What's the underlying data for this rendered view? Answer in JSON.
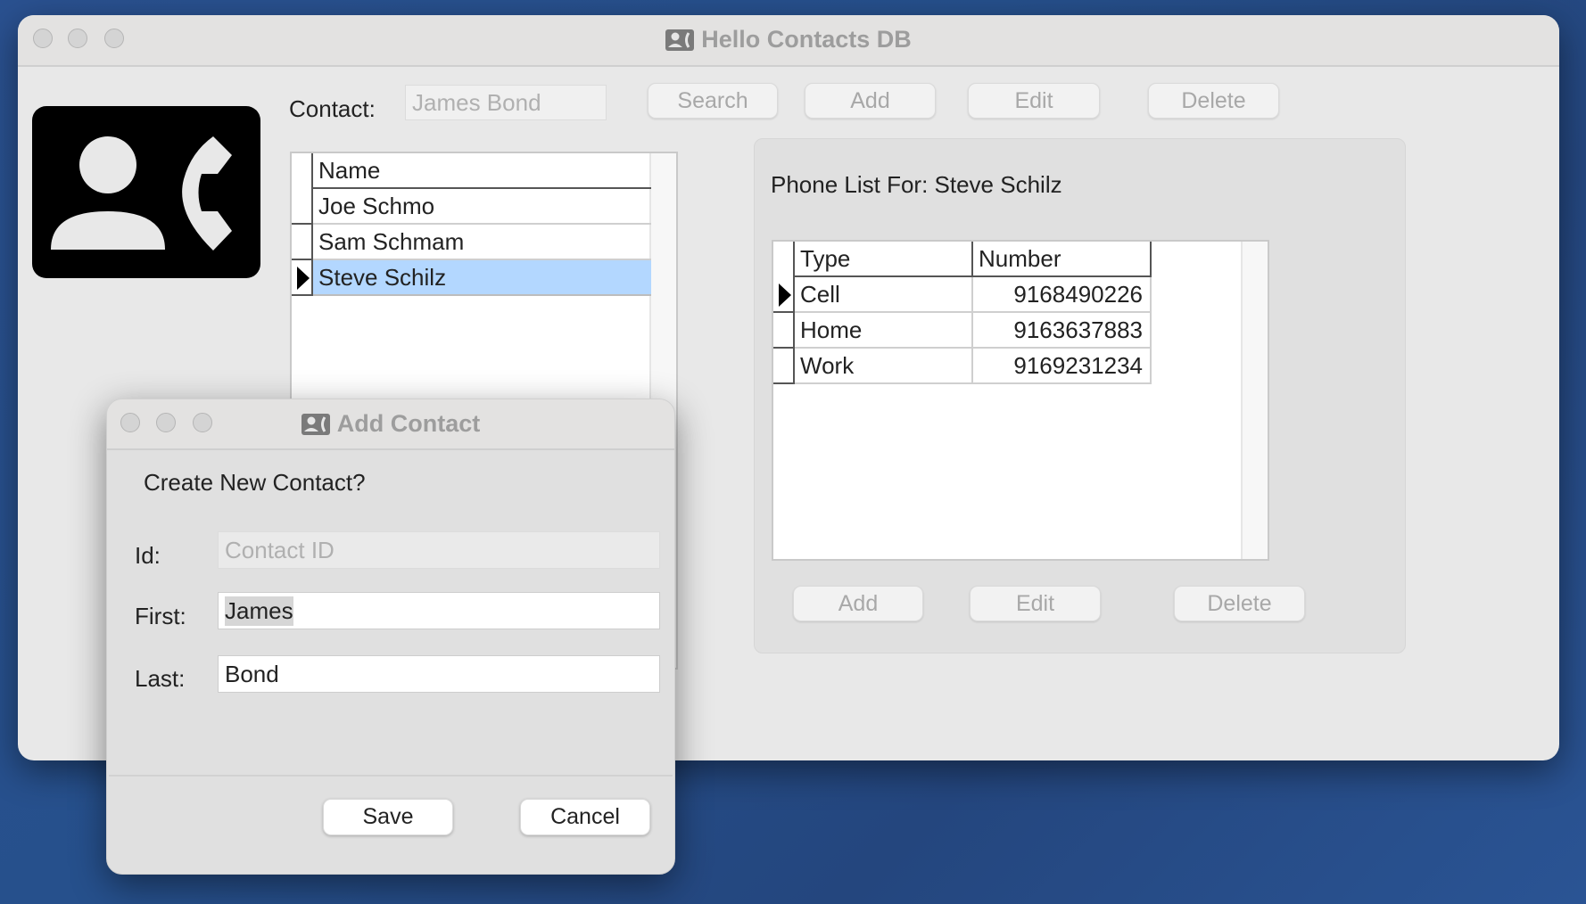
{
  "main_window": {
    "title": "Hello Contacts DB",
    "title_icon": "contact-phone-icon",
    "avatar_icon": "contact-phone-icon",
    "contact_label": "Contact:",
    "contact_input": {
      "value": "",
      "placeholder": "James Bond"
    },
    "toolbar": {
      "search": "Search",
      "add": "Add",
      "edit": "Edit",
      "delete": "Delete"
    },
    "names_table": {
      "columns": [
        "Name"
      ],
      "rows": [
        {
          "name": "Joe Schmo",
          "selected": false
        },
        {
          "name": "Sam Schmam",
          "selected": false
        },
        {
          "name": "Steve Schilz",
          "selected": true
        }
      ]
    },
    "phone_panel": {
      "title": "Phone List For: Steve Schilz",
      "columns": [
        "Type",
        "Number"
      ],
      "rows": [
        {
          "type": "Cell",
          "number": "9168490226",
          "current": true
        },
        {
          "type": "Home",
          "number": "9163637883",
          "current": false
        },
        {
          "type": "Work",
          "number": "9169231234",
          "current": false
        }
      ],
      "buttons": {
        "add": "Add",
        "edit": "Edit",
        "delete": "Delete"
      }
    }
  },
  "dialog": {
    "title": "Add Contact",
    "title_icon": "contact-phone-icon",
    "heading": "Create New Contact?",
    "fields": {
      "id": {
        "label": "Id:",
        "value": "",
        "placeholder": "Contact ID"
      },
      "first": {
        "label": "First:",
        "value": "James"
      },
      "last": {
        "label": "Last:",
        "value": "Bond"
      }
    },
    "buttons": {
      "save": "Save",
      "cancel": "Cancel"
    }
  },
  "colors": {
    "selection": "#b3d7ff",
    "desktop": "#27508c"
  }
}
